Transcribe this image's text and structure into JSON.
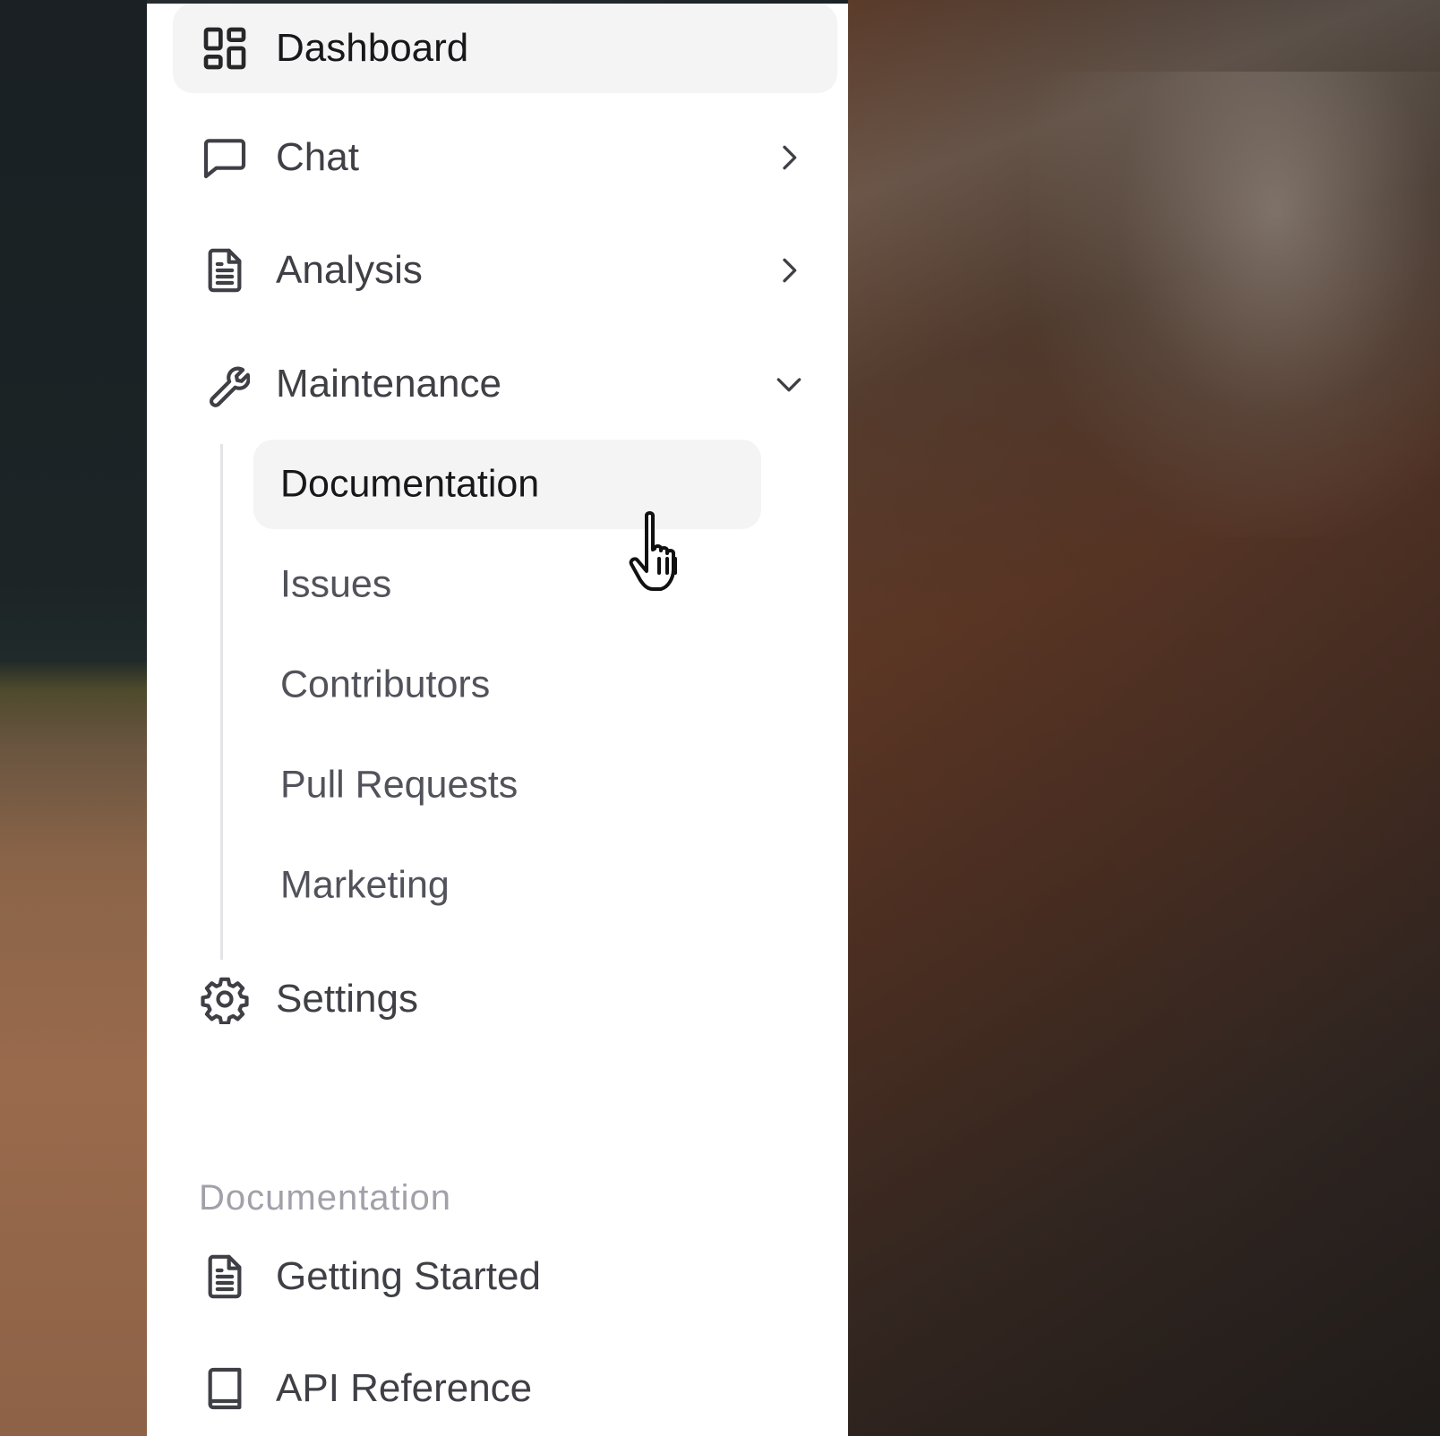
{
  "nav": {
    "items": [
      {
        "label": "Dashboard",
        "icon": "dashboard-grid-icon",
        "active": true
      },
      {
        "label": "Chat",
        "icon": "chat-bubble-icon",
        "chevron": "right"
      },
      {
        "label": "Analysis",
        "icon": "document-icon",
        "chevron": "right"
      },
      {
        "label": "Maintenance",
        "icon": "wrench-icon",
        "chevron": "down",
        "expanded": true
      },
      {
        "label": "Settings",
        "icon": "gear-icon"
      }
    ],
    "maintenance_sub": [
      {
        "label": "Documentation",
        "active": true
      },
      {
        "label": "Issues"
      },
      {
        "label": "Contributors"
      },
      {
        "label": "Pull Requests"
      },
      {
        "label": "Marketing"
      }
    ]
  },
  "docs": {
    "title": "Documentation",
    "items": [
      {
        "label": "Getting Started",
        "icon": "document-icon"
      },
      {
        "label": "API Reference",
        "icon": "book-icon"
      }
    ]
  },
  "colors": {
    "active_bg": "#f4f4f5",
    "text": "#3f3f46",
    "muted": "#a1a1aa",
    "rail": "#e4e4e7"
  }
}
